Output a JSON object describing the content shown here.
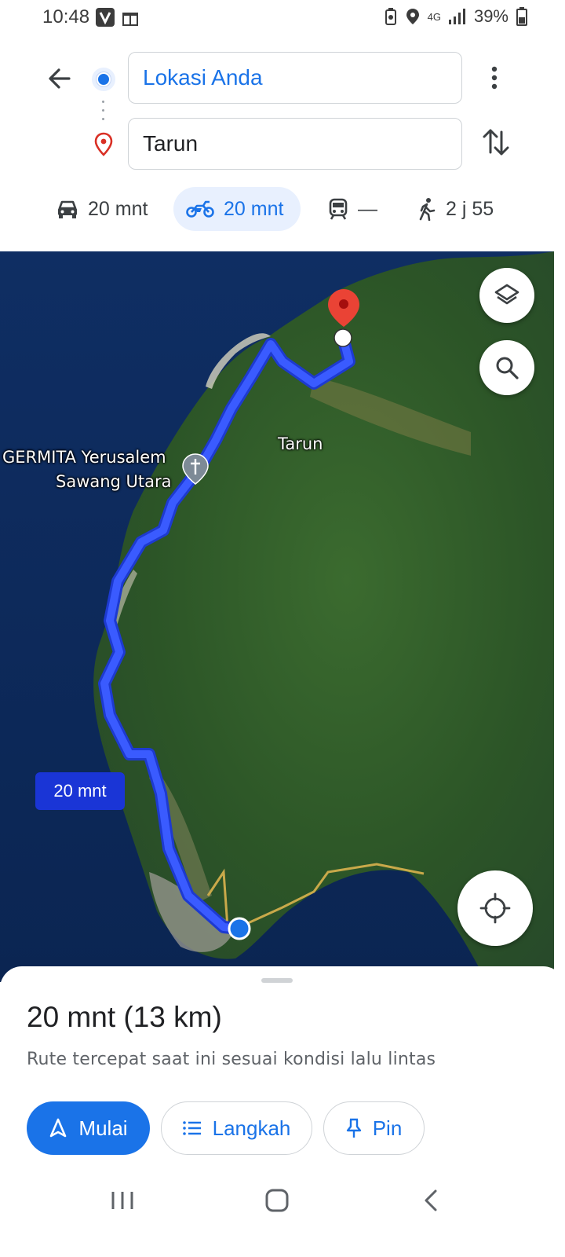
{
  "status_bar": {
    "time": "10:48",
    "network": "4G",
    "battery": "39%"
  },
  "directions": {
    "origin": "Lokasi Anda",
    "destination": "Tarun",
    "modes": [
      {
        "name": "car",
        "time": "20 mnt",
        "icon": "car-icon"
      },
      {
        "name": "motorcycle",
        "time": "20 mnt",
        "icon": "motorcycle-icon",
        "selected": true
      },
      {
        "name": "transit",
        "time": "—",
        "icon": "train-icon"
      },
      {
        "name": "walk",
        "time": "2 j 55",
        "icon": "walk-icon"
      }
    ]
  },
  "map": {
    "labels": {
      "area": "Tarun",
      "church_line1": "GERMITA Yerusalem",
      "church_line2": "Sawang Utara"
    },
    "route_eta": "20 mnt",
    "colors": {
      "route": "#2a3cf0",
      "pin": "#e53935",
      "sea": "#0d2a5a",
      "land": "#2f5a2a"
    }
  },
  "sheet": {
    "summary": "20 mnt (13 km)",
    "note": "Rute tercepat saat ini sesuai kondisi lalu lintas",
    "buttons": {
      "start": "Mulai",
      "steps": "Langkah",
      "pin": "Pin"
    }
  },
  "colors": {
    "accent": "#1a73e8"
  }
}
